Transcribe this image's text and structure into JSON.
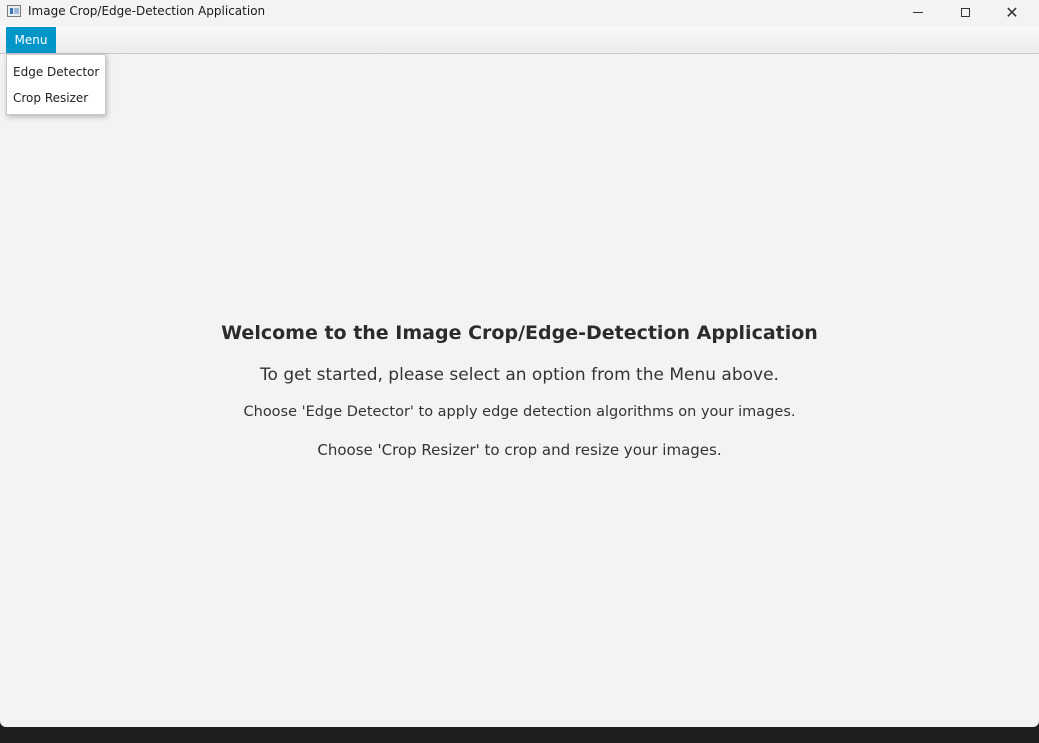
{
  "window": {
    "title": "Image Crop/Edge-Detection Application",
    "controls": {
      "minimize": "minimize",
      "maximize": "maximize",
      "close": "close"
    }
  },
  "menubar": {
    "menu_label": "Menu",
    "dropdown_items": [
      "Edge Detector",
      "Crop Resizer"
    ]
  },
  "content": {
    "welcome": "Welcome to the Image Crop/Edge-Detection Application",
    "instruction": "To get started, please select an option from the Menu above.",
    "edge_hint": "Choose 'Edge Detector' to apply edge detection algorithms on your images.",
    "crop_hint": "Choose 'Crop Resizer' to crop and resize your images."
  },
  "colors": {
    "menu_accent": "#0096c9",
    "background": "#f3f3f3"
  }
}
